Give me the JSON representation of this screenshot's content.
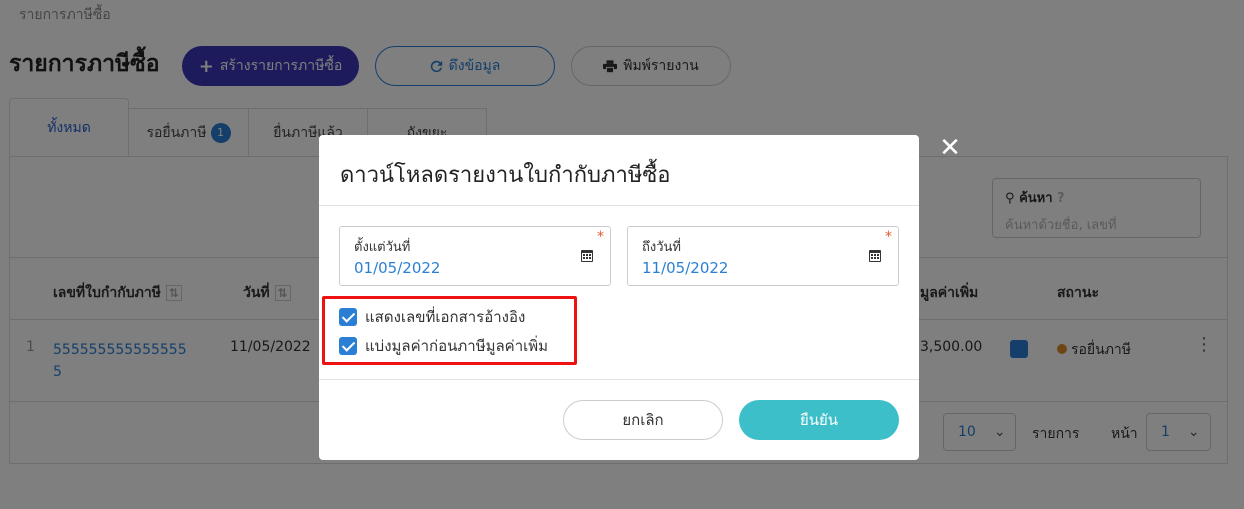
{
  "breadcrumb": "รายการภาษีซื้อ",
  "page_title": "รายการภาษีซื้อ",
  "toolbar": {
    "create_label": "สร้างรายการภาษีซื้อ",
    "fetch_label": "ดึงข้อมูล",
    "print_label": "พิมพ์รายงาน"
  },
  "tabs": [
    {
      "label": "ทั้งหมด"
    },
    {
      "label": "รอยื่นภาษี",
      "badge": "1"
    },
    {
      "label": "ยื่นภาษีแล้ว"
    },
    {
      "label": "ถังขยะ"
    }
  ],
  "search": {
    "label": "ค้นหา",
    "placeholder": "ค้นหาด้วยชื่อ, เลขที่"
  },
  "table": {
    "headers": {
      "invoice_no": "เลขที่ใบกำกับภาษี",
      "date": "วันที่",
      "vat": "มูลค่าเพิ่ม",
      "status": "สถานะ"
    },
    "rows": [
      {
        "index": "1",
        "invoice_no": "5555555555555555",
        "date": "11/05/2022",
        "vat_amount": "3,500.00",
        "status": "รอยื่นภาษี"
      }
    ]
  },
  "pagination": {
    "page_size": "10",
    "items_label": "รายการ",
    "page_label": "หน้า",
    "page": "1"
  },
  "modal": {
    "title": "ดาวน์โหลดรายงานใบกำกับภาษีซื้อ",
    "from_label": "ตั้งแต่วันที่",
    "from_value": "01/05/2022",
    "to_label": "ถึงวันที่",
    "to_value": "11/05/2022",
    "required_mark": "*",
    "option_show_ref": "แสดงเลขที่เอกสารอ้างอิง",
    "option_split_vat": "แบ่งมูลค่าก่อนภาษีมูลค่าเพิ่ม",
    "cancel_label": "ยกเลิก",
    "confirm_label": "ยืนยัน"
  },
  "colors": {
    "primary": "#3a37b8",
    "link": "#2a7fd4",
    "confirm": "#3cbfc9",
    "highlight": "#ee1111",
    "status_dot": "#e08a2a"
  }
}
